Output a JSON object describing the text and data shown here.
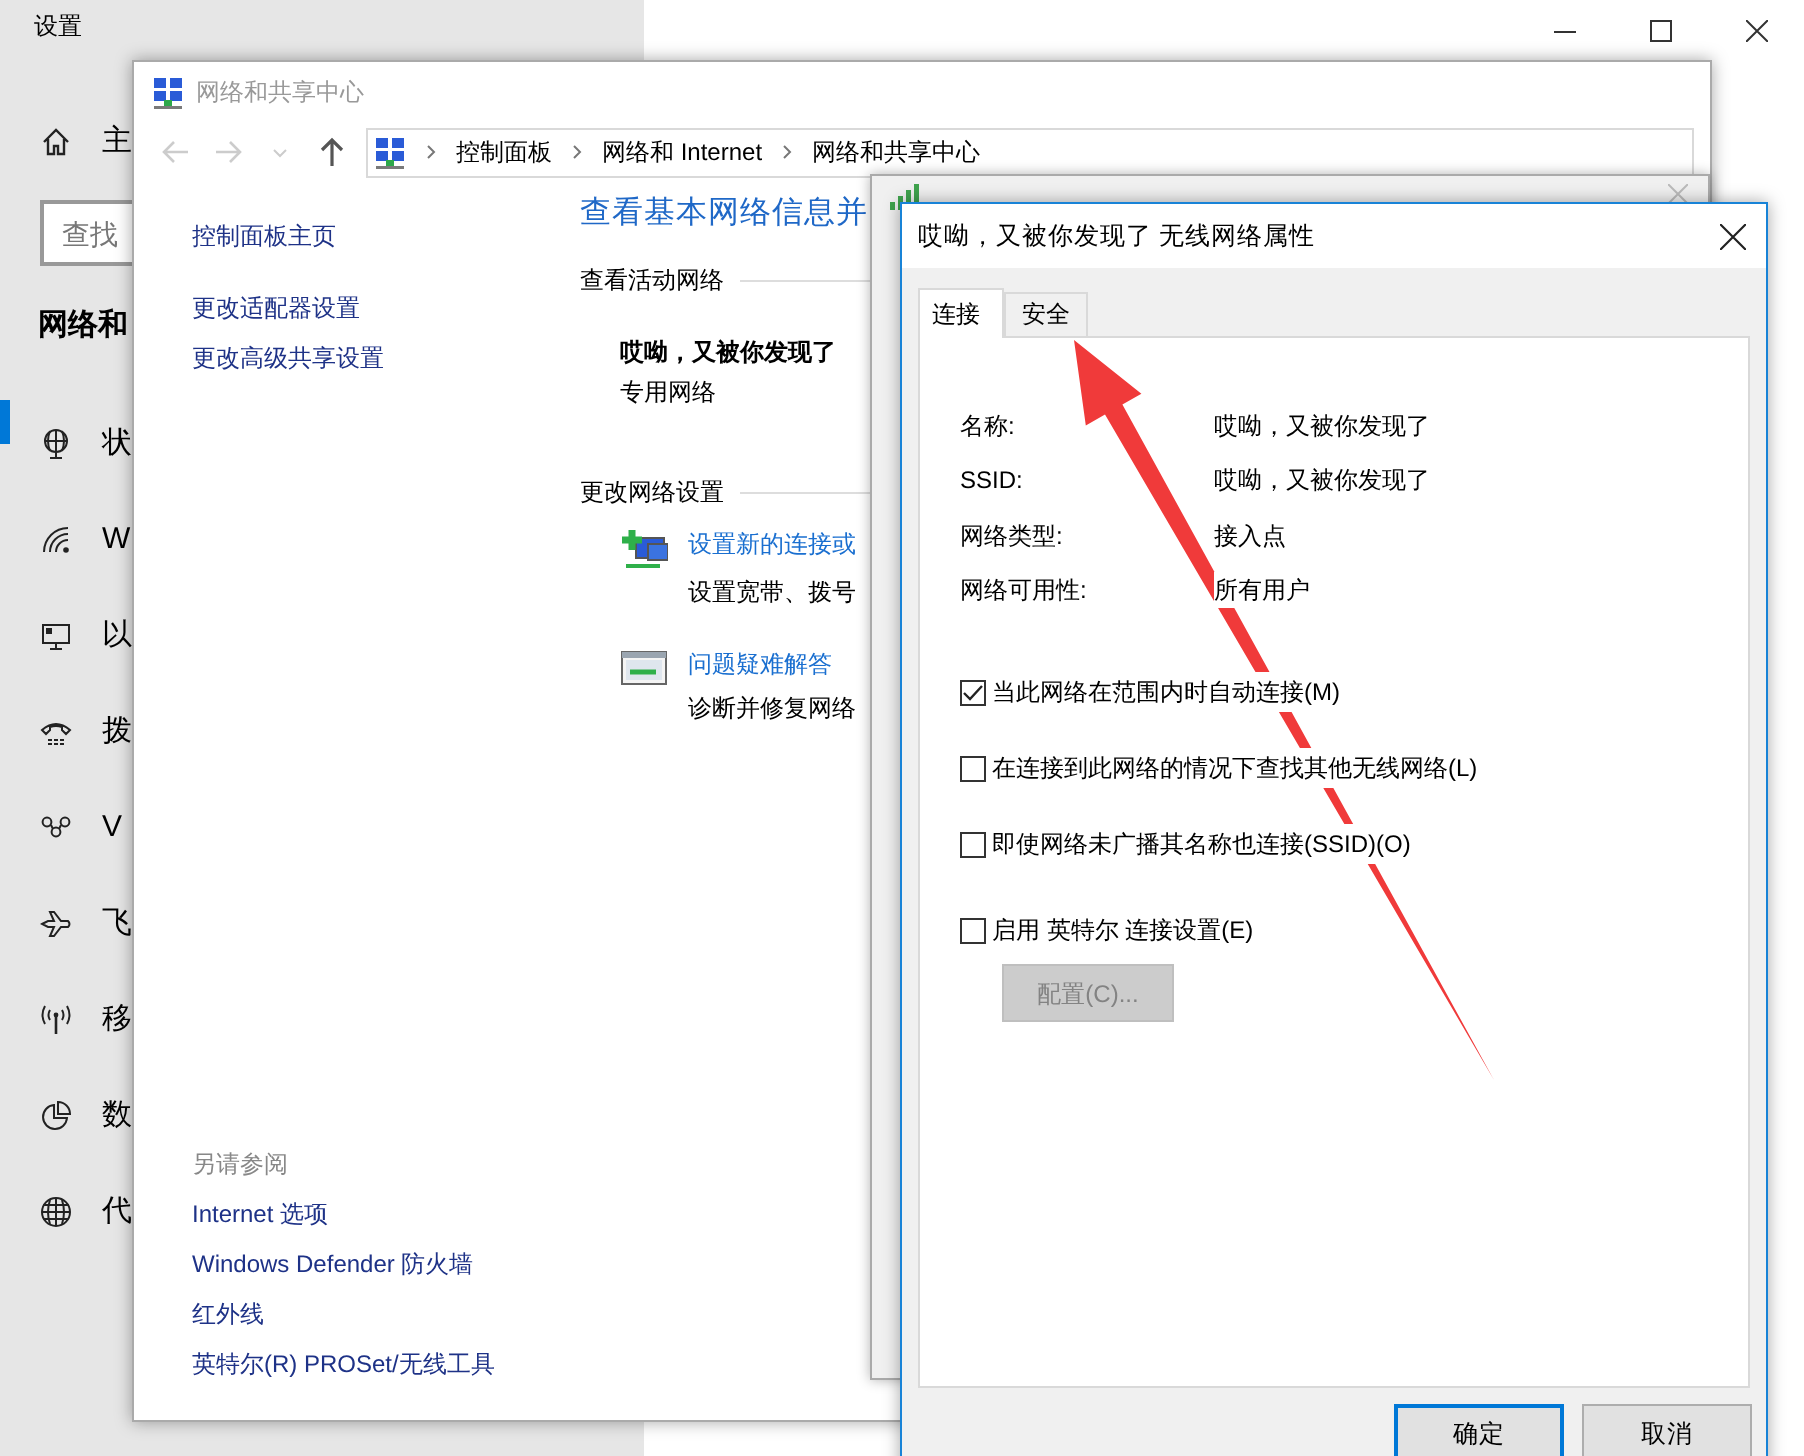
{
  "settings_window": {
    "title": "设置",
    "home_label": "主",
    "search": {
      "placeholder": "查找"
    },
    "section_title": "网络和",
    "nav_items": [
      {
        "label": "状",
        "selected": true
      },
      {
        "label": "W",
        "selected": false
      },
      {
        "label": "以",
        "selected": false
      },
      {
        "label": "拨",
        "selected": false
      },
      {
        "label": "V",
        "selected": false
      },
      {
        "label": "飞",
        "selected": false
      },
      {
        "label": "移",
        "selected": false
      },
      {
        "label": "数",
        "selected": false
      },
      {
        "label": "代",
        "selected": false
      }
    ]
  },
  "control_panel_window": {
    "title": "网络和共享中心",
    "breadcrumbs": [
      "控制面板",
      "网络和 Internet",
      "网络和共享中心"
    ],
    "sidebar_links": [
      "控制面板主页",
      "更改适配器设置",
      "更改高级共享设置"
    ],
    "heading": "查看基本网络信息并",
    "active_networks_label": "查看活动网络",
    "network_name": "哎呦，又被你发现了",
    "network_type": "专用网络",
    "change_settings_label": "更改网络设置",
    "tasks": [
      {
        "link": "设置新的连接或",
        "description": "设置宽带、拨号"
      },
      {
        "link": "问题疑难解答",
        "description": "诊断并修复网络"
      }
    ],
    "see_also_label": "另请参阅",
    "see_also_links": [
      "Internet 选项",
      "Windows Defender 防火墙",
      "红外线",
      "英特尔(R) PROSet/无线工具"
    ]
  },
  "properties_dialog": {
    "title": "哎呦，又被你发现了 无线网络属性",
    "tabs": [
      {
        "label": "连接",
        "selected": true
      },
      {
        "label": "安全",
        "selected": false
      }
    ],
    "properties": [
      {
        "label": "名称:",
        "value": "哎呦，又被你发现了"
      },
      {
        "label": "SSID:",
        "value": "哎呦，又被你发现了"
      },
      {
        "label": "网络类型:",
        "value": "接入点"
      },
      {
        "label": "网络可用性:",
        "value": "所有用户"
      }
    ],
    "options": [
      {
        "label": "当此网络在范围内时自动连接(M)",
        "checked": true
      },
      {
        "label": "在连接到此网络的情况下查找其他无线网络(L)",
        "checked": false
      },
      {
        "label": "即使网络未广播其名称也连接(SSID)(O)",
        "checked": false
      },
      {
        "label": "启用 英特尔 连接设置(E)",
        "checked": false
      }
    ],
    "configure_button": {
      "label": "配置(C)...",
      "disabled": true
    },
    "buttons": [
      {
        "label": "确定",
        "default": true
      },
      {
        "label": "取消",
        "default": false
      }
    ]
  }
}
